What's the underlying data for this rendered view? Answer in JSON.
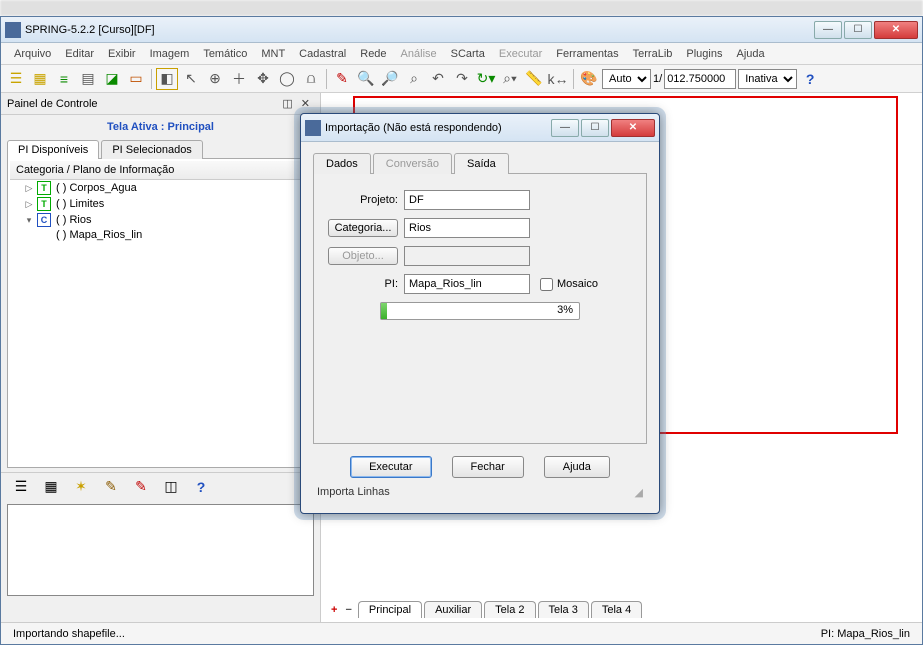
{
  "window": {
    "title": "SPRING-5.2.2 [Curso][DF]"
  },
  "menu": {
    "items": [
      "Arquivo",
      "Editar",
      "Exibir",
      "Imagem",
      "Temático",
      "MNT",
      "Cadastral",
      "Rede",
      "Análise",
      "SCarta",
      "Executar",
      "Ferramentas",
      "TerraLib",
      "Plugins",
      "Ajuda"
    ],
    "disabled": [
      "Análise",
      "Executar"
    ]
  },
  "toolbar": {
    "scale_mode": "Auto",
    "scale_prefix": "1/",
    "scale_value": "012.750000",
    "state": "Inativa"
  },
  "panel": {
    "title": "Painel de Controle",
    "tela_ativa_label": "Tela Ativa : Principal",
    "tabs": {
      "disponiveis": "PI Disponíveis",
      "selecionados": "PI Selecionados"
    },
    "tree_header": "Categoria / Plano de Informação",
    "items": [
      {
        "icon": "T",
        "label": "( ) Corpos_Agua",
        "expand": "▷"
      },
      {
        "icon": "T",
        "label": "( ) Limites",
        "expand": "▷"
      },
      {
        "icon": "C",
        "label": "( ) Rios",
        "expand": "▼",
        "children": [
          {
            "label": "( ) Mapa_Rios_lin"
          }
        ]
      }
    ]
  },
  "canvas": {
    "tabs": [
      "Principal",
      "Auxiliar",
      "Tela 2",
      "Tela 3",
      "Tela 4"
    ]
  },
  "status": {
    "left": "Importando shapefile...",
    "right": "PI: Mapa_Rios_lin"
  },
  "dialog": {
    "title": "Importação (Não está respondendo)",
    "tabs": {
      "dados": "Dados",
      "conversao": "Conversão",
      "saida": "Saída"
    },
    "fields": {
      "projeto_label": "Projeto:",
      "projeto_value": "DF",
      "categoria_btn": "Categoria...",
      "categoria_value": "Rios",
      "objeto_btn": "Objeto...",
      "objeto_value": "",
      "pi_label": "PI:",
      "pi_value": "Mapa_Rios_lin",
      "mosaico_label": "Mosaico",
      "progress_pct": "3%"
    },
    "actions": {
      "executar": "Executar",
      "fechar": "Fechar",
      "ajuda": "Ajuda"
    },
    "status": "Importa Linhas"
  }
}
